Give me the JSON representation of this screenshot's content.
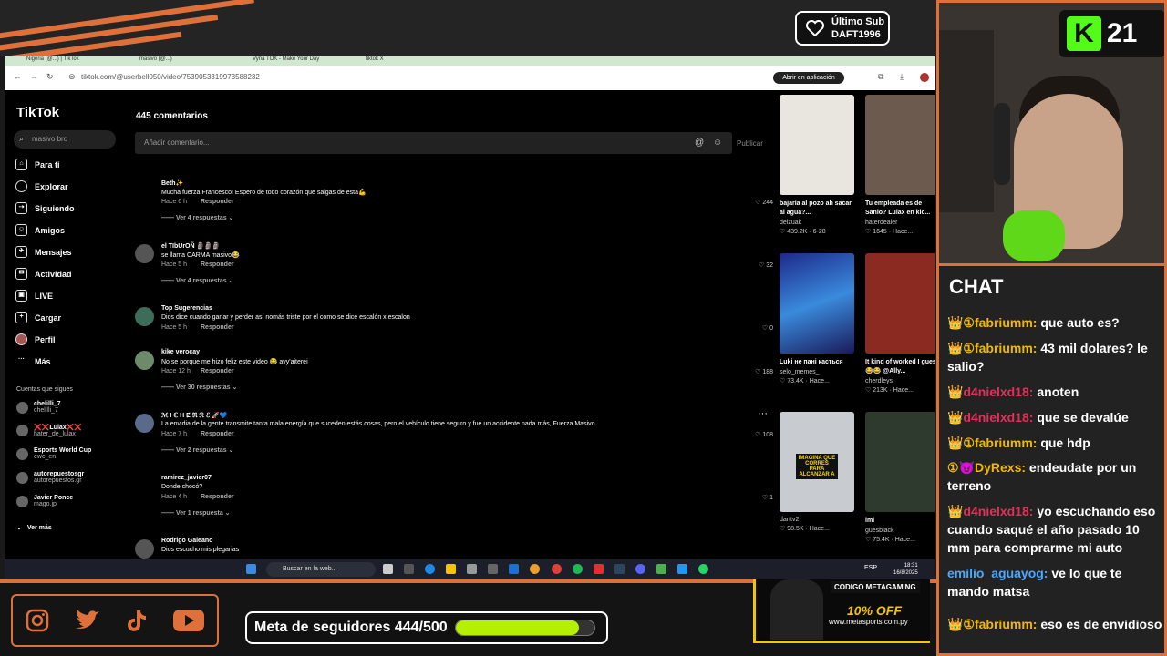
{
  "overlay": {
    "last_sub_title": "Último Sub",
    "last_sub_name": "DAFT1996",
    "follower_goal_label": "Meta de seguidores 444/500",
    "follower_goal_fraction": 0.888,
    "promo_code_label": "CODIGO METAGAMING",
    "promo_discount": "10% OFF",
    "promo_site": "www.metasports.com.py",
    "kick_viewers": "21",
    "social_icons": [
      "instagram-icon",
      "twitter-icon",
      "tiktok-icon",
      "youtube-icon"
    ]
  },
  "browser": {
    "tabs": [
      "Nigeria (@...) | TikTok",
      "masivo (@...)",
      "Vyna TOK - Make Your Day",
      "tiktok X"
    ],
    "url": "tiktok.com/@userbell050/video/7539053319973588232",
    "open_app_label": "Abrir en aplicación"
  },
  "tiktok": {
    "logo": "TikTok",
    "search_placeholder": "masivo bro",
    "nav": [
      "Para ti",
      "Explorar",
      "Siguiendo",
      "Amigos",
      "Mensajes",
      "Actividad",
      "LIVE",
      "Cargar",
      "Perfil",
      "Más"
    ],
    "following_header": "Cuentas que sigues",
    "following": [
      {
        "name": "chelilli_7",
        "handle": "chelilli_7"
      },
      {
        "name": "❌❌Lulax❌❌",
        "handle": "hater_de_lulax"
      },
      {
        "name": "Esports World Cup",
        "handle": "ewc_en"
      },
      {
        "name": "autorepuestosgr",
        "handle": "autorepuestos.gr"
      },
      {
        "name": "Javier Ponce",
        "handle": "mago.jp"
      }
    ],
    "see_more": "Ver más",
    "comment_count": "445 comentarios",
    "comment_placeholder": "Añadir comentario...",
    "post_label": "Publicar",
    "reply_label": "Responder",
    "comments": [
      {
        "user": "Beth✨",
        "text": "Mucha fuerza Francesco! Espero de todo corazón que salgas de esta💪",
        "time": "Hace 6 h",
        "likes": "244",
        "more": "Ver 4 respuestas"
      },
      {
        "user": "el TIbUrOÑ 🗿🗿🗿",
        "text": "se llama CARMA masivo😂",
        "time": "Hace 5 h",
        "likes": "32",
        "more": "Ver 4 respuestas"
      },
      {
        "user": "Top Sugerencias",
        "text": "Dios dice cuando ganar y perder así nomás triste por el como se dice escalón x escalon",
        "time": "Hace 5 h",
        "likes": "0",
        "more": ""
      },
      {
        "user": "kike verocay",
        "text": "No se porque me hizo feliz este video 😂 avy'aiterei",
        "time": "Hace 12 h",
        "likes": "188",
        "more": "Ver 30 respuestas"
      },
      {
        "user": "ℳ I ℂ H Ɇ ℜ ℛ ℰ 🚀💙",
        "text": "La envidia de la gente transmite tanta mala energía que suceden estás cosas, pero el vehículo tiene seguro y fue un accidente nada más, Fuerza Masivo.",
        "time": "Hace 7 h",
        "likes": "108",
        "more": "Ver 2 respuestas"
      },
      {
        "user": "ramirez_javier07",
        "text": "Donde chocó?",
        "time": "Hace 4 h",
        "likes": "1",
        "more": "Ver 1 respuesta"
      },
      {
        "user": "Rodrigo Galeano",
        "text": "Dios escucho mis plegarias",
        "time": "",
        "likes": "",
        "more": ""
      }
    ],
    "videos": [
      {
        "title": "bajaría al pozo ah sacar al agua?...",
        "author": "delzuak",
        "stats": "♡ 439.2K · 6-28",
        "color": "#e9e6e0"
      },
      {
        "title": "Tu empleada es de Sanlo? Lulax en kic...",
        "author": "haterdealer",
        "stats": "♡ 1645 · Hace...",
        "color": "#6b5a4d"
      },
      {
        "title": "Luki не пані касться",
        "author": "selo_memes_",
        "stats": "♡ 73.4K · Hace...",
        "color": "#3a4dcc"
      },
      {
        "title": "It kind of worked I guess 😂😂 @Ally...",
        "author": "cherdleys",
        "stats": "♡ 213K · Hace...",
        "color": "#8a2a20"
      },
      {
        "title": "",
        "author": "darttv2",
        "stats": "♡ 98.5K · Hace...",
        "color": "#4a4f55"
      },
      {
        "title": "",
        "author": "guesblack",
        "stats": "♡ 75.4K · Hace...",
        "color": "#2e3a2e"
      }
    ],
    "video_overlays": [
      "IMAGINA QUE CORRES PARA ALCANZAR A",
      "lml"
    ]
  },
  "taskbar": {
    "search_label": "Buscar en la web...",
    "time": "18:31",
    "date": "16/8/2025",
    "lang": "ESP"
  },
  "chat": {
    "title": "CHAT",
    "messages": [
      {
        "badge": "👑①",
        "user": "fabriumm:",
        "user_color": "#f2b800",
        "text": "que auto es?"
      },
      {
        "badge": "👑①",
        "user": "fabriumm:",
        "user_color": "#f2b800",
        "text": "43 mil dolares? le salio?"
      },
      {
        "badge": "👑",
        "user": "d4nielxd18:",
        "user_color": "#e0305a",
        "text": "anoten"
      },
      {
        "badge": "👑",
        "user": "d4nielxd18:",
        "user_color": "#e0305a",
        "text": "que se devalúe"
      },
      {
        "badge": "👑①",
        "user": "fabriumm:",
        "user_color": "#f2b800",
        "text": "que hdp"
      },
      {
        "badge": "①😈",
        "user": "DyRexs:",
        "user_color": "#f2b800",
        "text": "endeudate por un terreno"
      },
      {
        "badge": "👑",
        "user": "d4nielxd18:",
        "user_color": "#e0305a",
        "text": "yo escuchando eso cuando saqué el año pasado 10 mm para comprarme mi auto"
      },
      {
        "badge": "",
        "user": "emilio_aguayog:",
        "user_color": "#4aa8ff",
        "text": "ve lo que te mando matsa"
      },
      {
        "badge": "👑①",
        "user": "fabriumm:",
        "user_color": "#f2b800",
        "text": "eso es de envidioso"
      }
    ]
  }
}
